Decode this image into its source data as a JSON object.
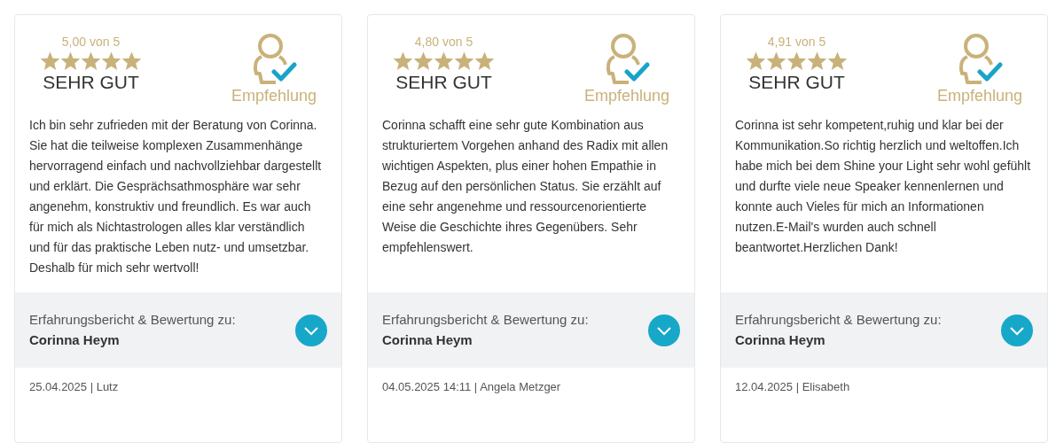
{
  "reviews": [
    {
      "rating": "5,00 von 5",
      "stars": 5,
      "verdict": "SEHR GUT",
      "badge": "Empfehlung",
      "text": "Ich bin sehr zufrieden mit der Beratung von Corinna. Sie hat die teilweise komplexen Zusammenhänge hervorragend einfach und nachvollziehbar dargestellt und erklärt. Die Gesprächsathmosphäre war sehr angenehm, konstruktiv und freundlich. Es war auch für mich als Nichtastrologen alles klar verständlich und für das praktische Leben nutz- und umsetzbar. Deshalb für mich sehr wertvoll!",
      "about_label": "Erfahrungsbericht & Bewertung zu:",
      "about_name": "Corinna Heym",
      "footer": "25.04.2025 | Lutz"
    },
    {
      "rating": "4,80 von 5",
      "stars": 5,
      "verdict": "SEHR GUT",
      "badge": "Empfehlung",
      "text": "Corinna schafft eine sehr gute Kombination aus strukturiertem Vorgehen anhand des Radix mit allen wichtigen Aspekten, plus einer hohen Empathie in Bezug auf den persönlichen Status. Sie erzählt auf eine sehr angenehme und ressourcenorientierte Weise die Geschichte ihres Gegenübers. Sehr empfehlenswert.",
      "about_label": "Erfahrungsbericht & Bewertung zu:",
      "about_name": "Corinna Heym",
      "footer": "04.05.2025 14:11 | Angela Metzger"
    },
    {
      "rating": "4,91 von 5",
      "stars": 5,
      "verdict": "SEHR GUT",
      "badge": "Empfehlung",
      "text": "Corinna ist sehr kompetent,ruhig und klar bei der Kommunikation.So richtig herzlich und weltoffen.Ich habe mich bei dem Shine your Light sehr wohl gefühlt und durfte viele neue Speaker kennenlernen und konnte auch Vieles für mich an Informationen nutzen.E-Mail's wurden auch schnell beantwortet.Herzlichen Dank!",
      "about_label": "Erfahrungsbericht & Bewertung zu:",
      "about_name": "Corinna Heym",
      "footer": "12.04.2025 | Elisabeth"
    }
  ]
}
